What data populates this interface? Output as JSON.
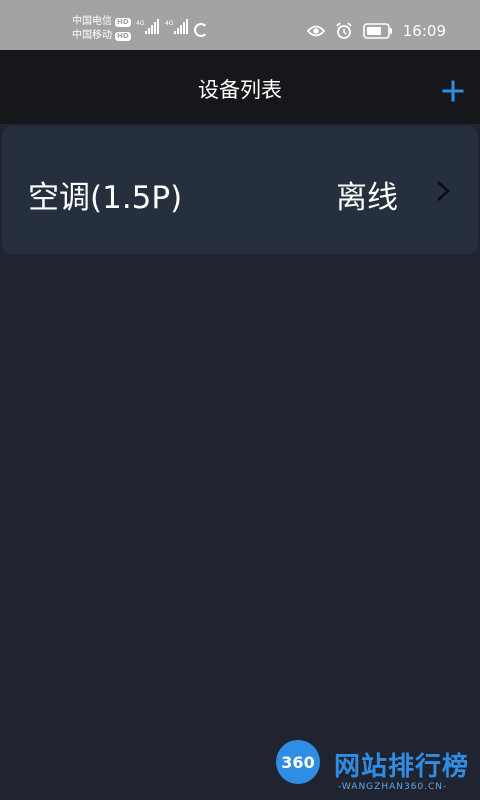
{
  "status_bar": {
    "carrier_1": "中国电信",
    "carrier_2": "中国移动",
    "hd_1": "HD",
    "hd_2": "HD",
    "network_1": "4G",
    "network_2": "4G",
    "time": "16:09"
  },
  "header": {
    "title": "设备列表",
    "add_icon": "plus-icon",
    "accent_color": "#2f8de4"
  },
  "devices": [
    {
      "name": "空调(1.5P)",
      "status": "离线"
    }
  ],
  "watermark": {
    "logo_text": "360",
    "title": "网站排行榜",
    "subtitle": "-WANGZHAN360.CN-"
  }
}
